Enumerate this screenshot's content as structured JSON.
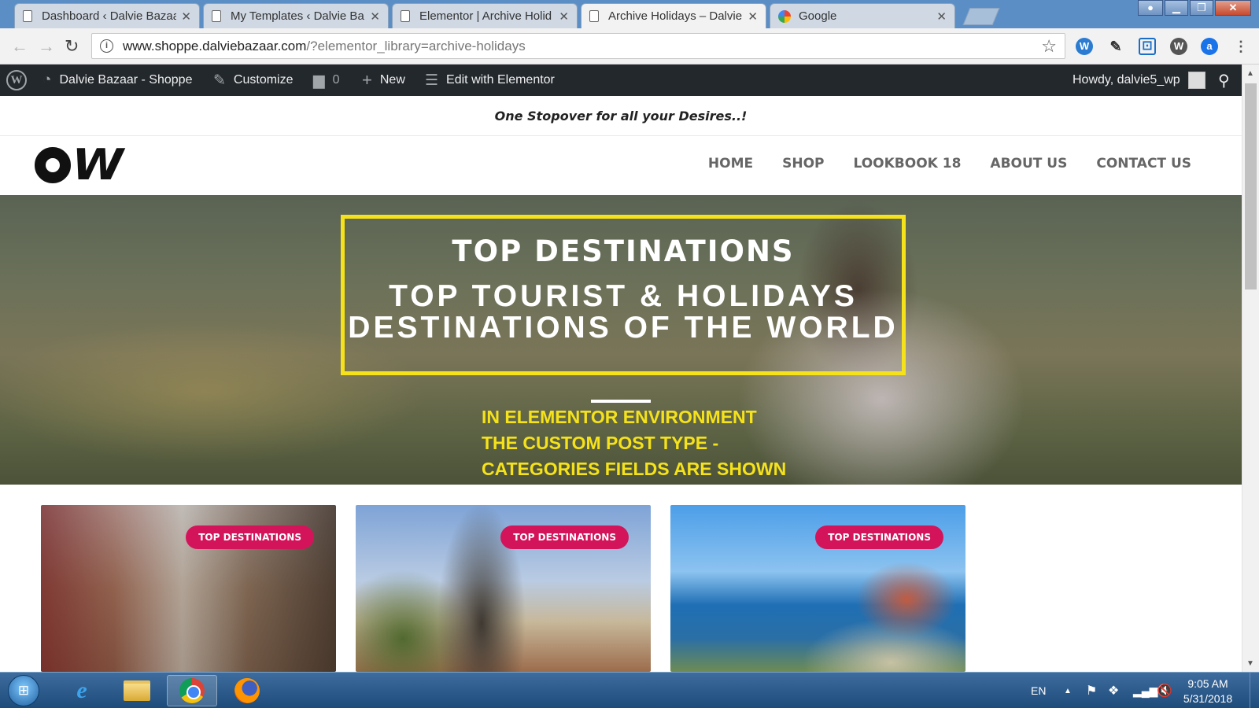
{
  "browser": {
    "tabs": [
      {
        "label": "Dashboard ‹ Dalvie Bazaar",
        "active": false,
        "icon": "doc-icon"
      },
      {
        "label": "My Templates ‹ Dalvie Ba",
        "active": false,
        "icon": "doc-icon"
      },
      {
        "label": "Elementor | Archive Holid",
        "active": false,
        "icon": "doc-icon"
      },
      {
        "label": "Archive Holidays – Dalvie",
        "active": true,
        "icon": "doc-icon"
      },
      {
        "label": "Google",
        "active": false,
        "icon": "google-icon"
      }
    ],
    "tab_close": "✕",
    "url_host": "www.shoppe.dalviebazaar.com",
    "url_path": "/?elementor_library=archive-holidays"
  },
  "adminbar": {
    "site_name": "Dalvie Bazaar - Shoppe",
    "customize": "Customize",
    "comments_count": "0",
    "new": "New",
    "edit_with": "Edit with Elementor",
    "howdy": "Howdy, dalvie5_wp"
  },
  "site": {
    "tagline": "One Stopover for all your Desires..!",
    "menu": [
      "HOME",
      "SHOP",
      "LOOKBOOK 18",
      "ABOUT US",
      "CONTACT US"
    ]
  },
  "hero": {
    "title": "TOP DESTINATIONS",
    "subtitle_line1": "TOP TOURIST & HOLIDAYS",
    "subtitle_line2": "DESTINATIONS OF THE WORLD",
    "note_line1": "IN ELEMENTOR ENVIRONMENT",
    "note_line2": "THE CUSTOM POST TYPE -",
    "note_line3": "CATEGORIES FIELDS ARE SHOWN"
  },
  "cards": [
    {
      "badge": "TOP DESTINATIONS"
    },
    {
      "badge": "TOP DESTINATIONS"
    },
    {
      "badge": "TOP DESTINATIONS"
    }
  ],
  "taskbar": {
    "language": "EN",
    "time": "9:05 AM",
    "date": "5/31/2018"
  }
}
